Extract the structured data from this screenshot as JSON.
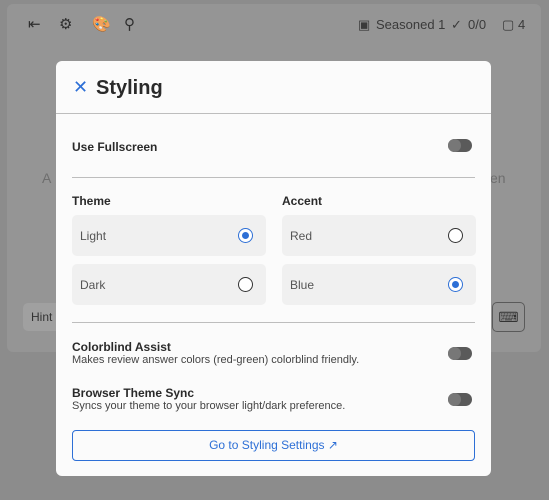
{
  "topbar": {
    "seasoned": "Seasoned 1",
    "done": "0/0",
    "cards": "4"
  },
  "background": {
    "text_left": "A",
    "text_right": "en",
    "hint": "Hint"
  },
  "modal": {
    "title": "Styling",
    "fullscreen": {
      "label": "Use Fullscreen",
      "on": false
    },
    "theme": {
      "label": "Theme",
      "options": [
        {
          "label": "Light",
          "selected": true
        },
        {
          "label": "Dark",
          "selected": false
        }
      ]
    },
    "accent": {
      "label": "Accent",
      "options": [
        {
          "label": "Red",
          "selected": false
        },
        {
          "label": "Blue",
          "selected": true
        }
      ]
    },
    "colorblind": {
      "label": "Colorblind Assist",
      "description": "Makes review answer colors (red-green) colorblind friendly.",
      "on": false
    },
    "sync": {
      "label": "Browser Theme Sync",
      "description": "Syncs your theme to your browser light/dark preference.",
      "on": false
    },
    "button": "Go to Styling Settings"
  },
  "colors": {
    "accent": "#2d6fd6"
  }
}
